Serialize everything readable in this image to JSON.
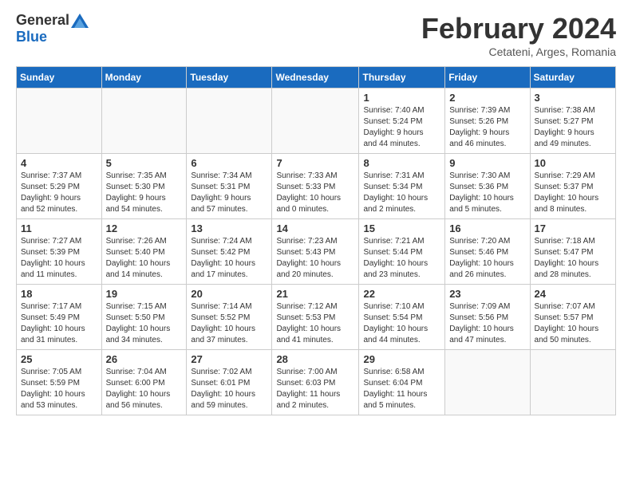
{
  "header": {
    "logo_general": "General",
    "logo_blue": "Blue",
    "month_title": "February 2024",
    "location": "Cetateni, Arges, Romania"
  },
  "days_of_week": [
    "Sunday",
    "Monday",
    "Tuesday",
    "Wednesday",
    "Thursday",
    "Friday",
    "Saturday"
  ],
  "rows": [
    [
      {
        "num": "",
        "info": ""
      },
      {
        "num": "",
        "info": ""
      },
      {
        "num": "",
        "info": ""
      },
      {
        "num": "",
        "info": ""
      },
      {
        "num": "1",
        "info": "Sunrise: 7:40 AM\nSunset: 5:24 PM\nDaylight: 9 hours\nand 44 minutes."
      },
      {
        "num": "2",
        "info": "Sunrise: 7:39 AM\nSunset: 5:26 PM\nDaylight: 9 hours\nand 46 minutes."
      },
      {
        "num": "3",
        "info": "Sunrise: 7:38 AM\nSunset: 5:27 PM\nDaylight: 9 hours\nand 49 minutes."
      }
    ],
    [
      {
        "num": "4",
        "info": "Sunrise: 7:37 AM\nSunset: 5:29 PM\nDaylight: 9 hours\nand 52 minutes."
      },
      {
        "num": "5",
        "info": "Sunrise: 7:35 AM\nSunset: 5:30 PM\nDaylight: 9 hours\nand 54 minutes."
      },
      {
        "num": "6",
        "info": "Sunrise: 7:34 AM\nSunset: 5:31 PM\nDaylight: 9 hours\nand 57 minutes."
      },
      {
        "num": "7",
        "info": "Sunrise: 7:33 AM\nSunset: 5:33 PM\nDaylight: 10 hours\nand 0 minutes."
      },
      {
        "num": "8",
        "info": "Sunrise: 7:31 AM\nSunset: 5:34 PM\nDaylight: 10 hours\nand 2 minutes."
      },
      {
        "num": "9",
        "info": "Sunrise: 7:30 AM\nSunset: 5:36 PM\nDaylight: 10 hours\nand 5 minutes."
      },
      {
        "num": "10",
        "info": "Sunrise: 7:29 AM\nSunset: 5:37 PM\nDaylight: 10 hours\nand 8 minutes."
      }
    ],
    [
      {
        "num": "11",
        "info": "Sunrise: 7:27 AM\nSunset: 5:39 PM\nDaylight: 10 hours\nand 11 minutes."
      },
      {
        "num": "12",
        "info": "Sunrise: 7:26 AM\nSunset: 5:40 PM\nDaylight: 10 hours\nand 14 minutes."
      },
      {
        "num": "13",
        "info": "Sunrise: 7:24 AM\nSunset: 5:42 PM\nDaylight: 10 hours\nand 17 minutes."
      },
      {
        "num": "14",
        "info": "Sunrise: 7:23 AM\nSunset: 5:43 PM\nDaylight: 10 hours\nand 20 minutes."
      },
      {
        "num": "15",
        "info": "Sunrise: 7:21 AM\nSunset: 5:44 PM\nDaylight: 10 hours\nand 23 minutes."
      },
      {
        "num": "16",
        "info": "Sunrise: 7:20 AM\nSunset: 5:46 PM\nDaylight: 10 hours\nand 26 minutes."
      },
      {
        "num": "17",
        "info": "Sunrise: 7:18 AM\nSunset: 5:47 PM\nDaylight: 10 hours\nand 28 minutes."
      }
    ],
    [
      {
        "num": "18",
        "info": "Sunrise: 7:17 AM\nSunset: 5:49 PM\nDaylight: 10 hours\nand 31 minutes."
      },
      {
        "num": "19",
        "info": "Sunrise: 7:15 AM\nSunset: 5:50 PM\nDaylight: 10 hours\nand 34 minutes."
      },
      {
        "num": "20",
        "info": "Sunrise: 7:14 AM\nSunset: 5:52 PM\nDaylight: 10 hours\nand 37 minutes."
      },
      {
        "num": "21",
        "info": "Sunrise: 7:12 AM\nSunset: 5:53 PM\nDaylight: 10 hours\nand 41 minutes."
      },
      {
        "num": "22",
        "info": "Sunrise: 7:10 AM\nSunset: 5:54 PM\nDaylight: 10 hours\nand 44 minutes."
      },
      {
        "num": "23",
        "info": "Sunrise: 7:09 AM\nSunset: 5:56 PM\nDaylight: 10 hours\nand 47 minutes."
      },
      {
        "num": "24",
        "info": "Sunrise: 7:07 AM\nSunset: 5:57 PM\nDaylight: 10 hours\nand 50 minutes."
      }
    ],
    [
      {
        "num": "25",
        "info": "Sunrise: 7:05 AM\nSunset: 5:59 PM\nDaylight: 10 hours\nand 53 minutes."
      },
      {
        "num": "26",
        "info": "Sunrise: 7:04 AM\nSunset: 6:00 PM\nDaylight: 10 hours\nand 56 minutes."
      },
      {
        "num": "27",
        "info": "Sunrise: 7:02 AM\nSunset: 6:01 PM\nDaylight: 10 hours\nand 59 minutes."
      },
      {
        "num": "28",
        "info": "Sunrise: 7:00 AM\nSunset: 6:03 PM\nDaylight: 11 hours\nand 2 minutes."
      },
      {
        "num": "29",
        "info": "Sunrise: 6:58 AM\nSunset: 6:04 PM\nDaylight: 11 hours\nand 5 minutes."
      },
      {
        "num": "",
        "info": ""
      },
      {
        "num": "",
        "info": ""
      }
    ]
  ]
}
